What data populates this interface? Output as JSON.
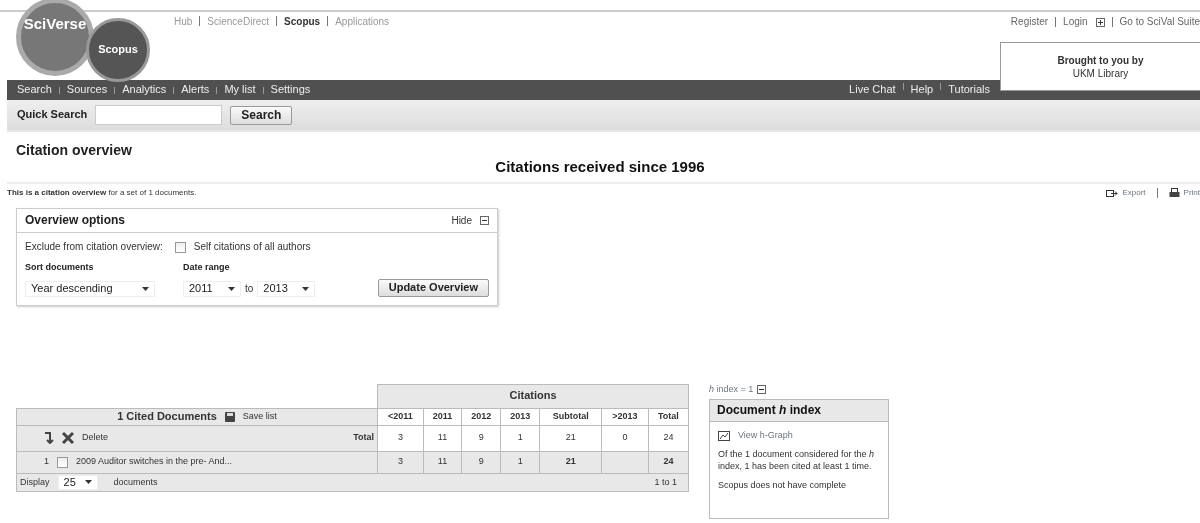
{
  "header": {
    "logo": {
      "brand": "SciVerse",
      "product": "Scopus"
    },
    "top_links": [
      {
        "label": "Hub",
        "selected": false
      },
      {
        "label": "ScienceDirect",
        "selected": false
      },
      {
        "label": "Scopus",
        "selected": true
      },
      {
        "label": "Applications",
        "selected": false
      }
    ],
    "account_links": [
      "Register",
      "Login",
      "Go to SciVal Suite"
    ],
    "brought_by": {
      "line1": "Brought to you by",
      "line2": "UKM Library"
    }
  },
  "nav": {
    "main_items": [
      "Search",
      "Sources",
      "Analytics",
      "Alerts",
      "My list",
      "Settings"
    ],
    "right_items": [
      "Live Chat",
      "Help",
      "Tutorials"
    ]
  },
  "quick_search": {
    "label": "Quick Search",
    "button": "Search"
  },
  "page_title": "Citation overview",
  "subtitle": "Citations received since 1996",
  "intro": "**This is a citation overview** for a set of 1 documents.",
  "actions": [
    "Export",
    "Print"
  ],
  "overview_options": {
    "title": "Overview options",
    "hide_label": "Hide",
    "exclude_label": "Exclude from citation overview:",
    "self_citations": {
      "label": "Self citations of all authors",
      "checked": false
    },
    "sort_label": "Sort documents",
    "sort_value": "Year descending",
    "date_label": "Date range",
    "from": "2011",
    "to_word": "to",
    "to": "2013",
    "button": "Update Overview"
  },
  "documents_table": {
    "heading": "1 Cited Documents",
    "save_label": "Save list",
    "delete_label": "Delete",
    "total_label": "Total",
    "citations_heading": "Citations",
    "columns": [
      "<2011",
      "2011",
      "2012",
      "2013",
      "Subtotal",
      ">2013",
      "Total"
    ],
    "totals": [
      "3",
      "11",
      "9",
      "1",
      "21",
      "0",
      "24"
    ],
    "rows": [
      {
        "index": "1",
        "checked": false,
        "title": "2009  Auditor switches in the pre- And...",
        "cells": [
          {
            "value": "3"
          },
          {
            "value": "11"
          },
          {
            "value": "9"
          },
          {
            "value": "1"
          },
          {
            "value": "21"
          },
          {},
          {
            "value": "24"
          }
        ]
      }
    ],
    "display_label": "Display",
    "display_value": "25",
    "display_suffix": "documents",
    "range": "1 to 1"
  },
  "h_index": {
    "summary": "*h* index = 1",
    "title": "Document *h* index",
    "graph_link": "View h-Graph",
    "description": "Of the 1 document considered for the *h* index, 1 has been cited at least 1 time.",
    "note": "Scopus does not have complete"
  }
}
